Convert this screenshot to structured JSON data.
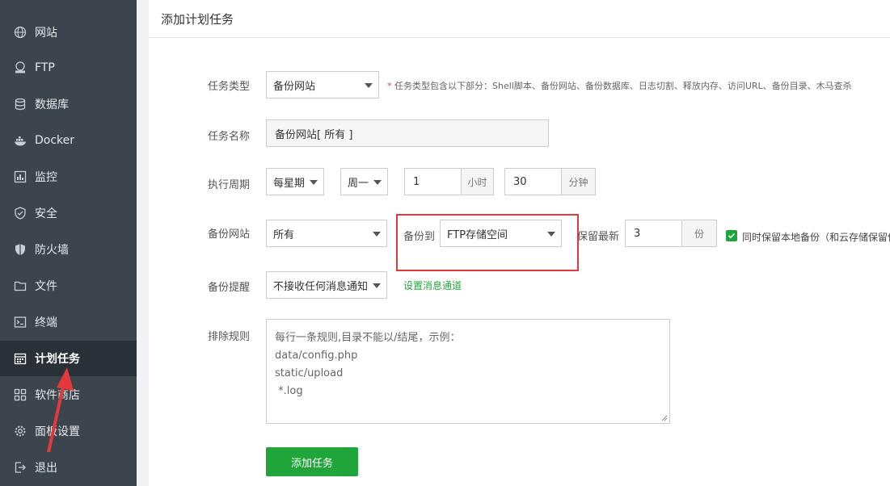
{
  "sidebar": {
    "items": [
      {
        "label": "网站",
        "icon": "globe-icon"
      },
      {
        "label": "FTP",
        "icon": "ftp-icon"
      },
      {
        "label": "数据库",
        "icon": "database-icon"
      },
      {
        "label": "Docker",
        "icon": "docker-icon"
      },
      {
        "label": "监控",
        "icon": "monitor-icon"
      },
      {
        "label": "安全",
        "icon": "shield-icon"
      },
      {
        "label": "防火墙",
        "icon": "firewall-icon"
      },
      {
        "label": "文件",
        "icon": "folder-icon"
      },
      {
        "label": "终端",
        "icon": "terminal-icon"
      },
      {
        "label": "计划任务",
        "icon": "calendar-icon",
        "active": true
      },
      {
        "label": "软件商店",
        "icon": "apps-icon"
      },
      {
        "label": "面板设置",
        "icon": "gear-icon"
      },
      {
        "label": "退出",
        "icon": "logout-icon"
      }
    ]
  },
  "panel": {
    "title": "添加计划任务"
  },
  "form": {
    "task_type": {
      "label": "任务类型",
      "value": "备份网站",
      "hint_star": "*",
      "hint": "任务类型包含以下部分：Shell脚本、备份网站、备份数据库、日志切割、释放内存、访问URL、备份目录、木马查杀"
    },
    "task_name": {
      "label": "任务名称",
      "value": "备份网站[ 所有 ]"
    },
    "cycle": {
      "label": "执行周期",
      "period": "每星期",
      "weekday": "周一",
      "hour": "1",
      "hour_unit": "小时",
      "minute": "30",
      "minute_unit": "分钟"
    },
    "backup_site": {
      "label": "备份网站",
      "value": "所有",
      "backup_to_label": "备份到",
      "backup_to": "FTP存储空间",
      "keep_label": "保留最新",
      "keep_value": "3",
      "keep_unit": "份",
      "keep_local_label": "同时保留本地备份（和云存储保留份"
    },
    "notify": {
      "label": "备份提醒",
      "value": "不接收任何消息通知",
      "link": "设置消息通道"
    },
    "exclude": {
      "label": "排除规则",
      "placeholder_lines": [
        "每行一条规则,目录不能以/结尾，示例：",
        "data/config.php",
        "static/upload",
        " *.log"
      ]
    },
    "submit": "添加任务"
  },
  "colors": {
    "sidebar_bg": "#3c444d",
    "sidebar_active": "#2a3038",
    "accent_green": "#20a53a",
    "highlight_red": "#e4393c"
  }
}
